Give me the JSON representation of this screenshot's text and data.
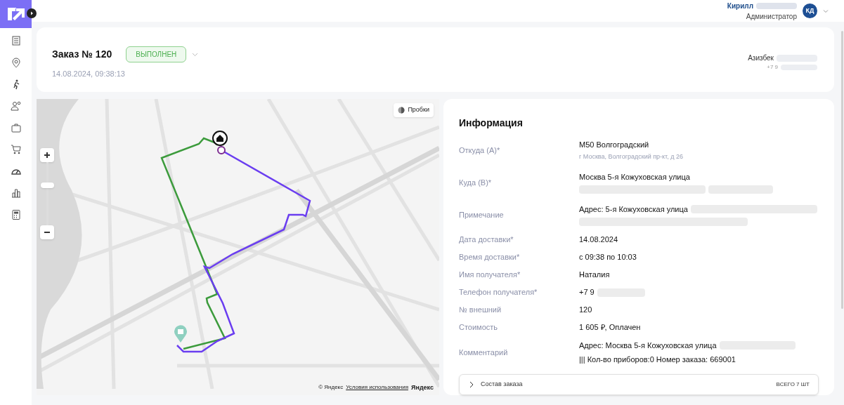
{
  "user": {
    "name": "Кирилл",
    "role": "Администратор",
    "initials": "КД"
  },
  "order": {
    "title": "Заказ № 120",
    "status": "ВЫПОЛНЕН",
    "created": "14.08.2024, 09:38:13",
    "courier": {
      "name": "Азизбек",
      "phone": "+7 9"
    }
  },
  "map": {
    "zoom": {
      "level": 0.63
    },
    "traffic_button": "Пробки",
    "attribution": "© Яндекс",
    "terms_link": "Условия использования",
    "brand": "Яндекс"
  },
  "info": {
    "title": "Информация",
    "fields": [
      {
        "label": "Откуда (A)*",
        "value": "М50 Волгоградский",
        "note": "г Москва, Волгоградский пр-кт, д 26",
        "redacted": false
      },
      {
        "label": "Куда (B)*",
        "value": "Москва 5-я Кожуховская улица",
        "redacted": true
      },
      {
        "label": "Примечание",
        "value": "Адрес: 5-я Кожуховская улица",
        "redacted": true
      },
      {
        "label": "Дата доставки*",
        "value": "14.08.2024",
        "redacted": false
      },
      {
        "label": "Время доставки*",
        "value": "с 09:38 по 10:03",
        "redacted": false
      },
      {
        "label": "Имя получателя*",
        "value": "Наталия",
        "redacted": false
      },
      {
        "label": "Телефон получателя*",
        "value": "+7 9",
        "redacted": true
      },
      {
        "label": "№ внешний",
        "value": "120",
        "redacted": false
      },
      {
        "label": "Стоимость",
        "value": "1 605 ₽, Оплачен",
        "redacted": false
      },
      {
        "label": "Комментарий",
        "value": "Адрес: Москва 5-я Кожуховская улица",
        "redacted": true,
        "text_after": "||| Кол-во приборов:0 Номер заказа: 669001"
      }
    ],
    "composition": {
      "label": "Состав заказа",
      "total": "ВСЕГО 7 ШТ",
      "expanded": false
    }
  }
}
